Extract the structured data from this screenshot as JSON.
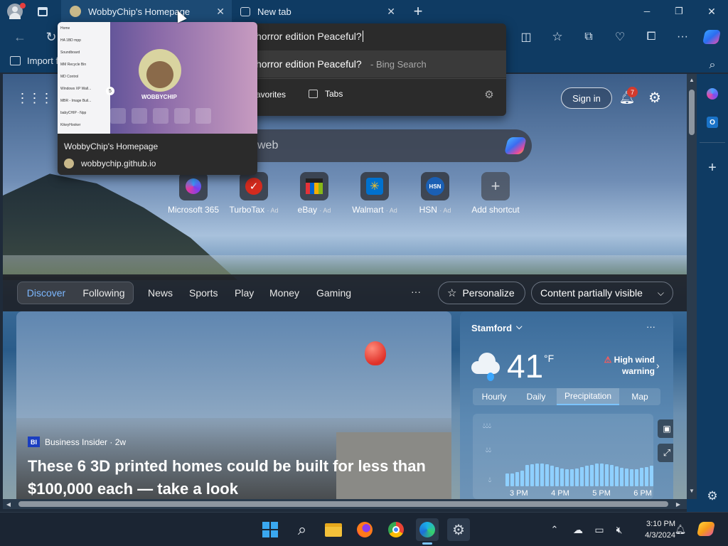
{
  "tabs": [
    {
      "title": "WobbyChip's Homepage"
    },
    {
      "title": "New tab"
    }
  ],
  "window": {
    "minimize": "─",
    "restore": "❐",
    "close": "✕"
  },
  "favorites_bar": {
    "import": "Import f"
  },
  "omnibox": {
    "text": "horror edition Peaceful?",
    "suggestion": "horror edition Peaceful?",
    "suggestion_source": "- Bing Search",
    "filters": [
      "avorites",
      "Tabs"
    ]
  },
  "hover_card": {
    "title": "WobbyChip's Homepage",
    "url": "wobbychip.github.io",
    "site_name": "WOBBYCHIP",
    "menu": [
      "Home",
      "HA 1BD mpp",
      "Soundboard",
      "MM Recycle Bin",
      "MD Control",
      "Windows XP Wall...",
      "MBR - Image Buil...",
      "babyCHIP - Npp",
      "KikeyHooker"
    ],
    "badge": "5"
  },
  "page": {
    "sign_in": "Sign in",
    "notifications": "7",
    "search_placeholder": "web"
  },
  "shortcuts": [
    {
      "name": "Microsoft 365",
      "ad": ""
    },
    {
      "name": "TurboTax",
      "ad": "· Ad"
    },
    {
      "name": "eBay",
      "ad": "· Ad"
    },
    {
      "name": "Walmart",
      "ad": "· Ad"
    },
    {
      "name": "HSN",
      "ad": "· Ad"
    },
    {
      "name": "Add shortcut",
      "ad": ""
    }
  ],
  "feed": {
    "tabs": [
      "Discover",
      "Following"
    ],
    "nav": [
      "News",
      "Sports",
      "Play",
      "Money",
      "Gaming"
    ],
    "more": "···",
    "personalize": "Personalize",
    "content": "Content partially visible"
  },
  "article": {
    "source_badge": "BI",
    "source": "Business Insider · 2w",
    "headline": "These 6 3D printed homes could be built for less than $100,000 each — take a look"
  },
  "weather": {
    "city": "Stamford",
    "temp": "41",
    "unit": "°F",
    "alert": "High wind warning",
    "tabs": [
      "Hourly",
      "Daily",
      "Precipitation",
      "Map"
    ],
    "active_tab": "Precipitation",
    "times": [
      "3 PM",
      "4 PM",
      "5 PM",
      "6 PM"
    ],
    "more": "···"
  },
  "taskbar": {
    "time": "3:10 PM",
    "date": "4/3/2024"
  }
}
